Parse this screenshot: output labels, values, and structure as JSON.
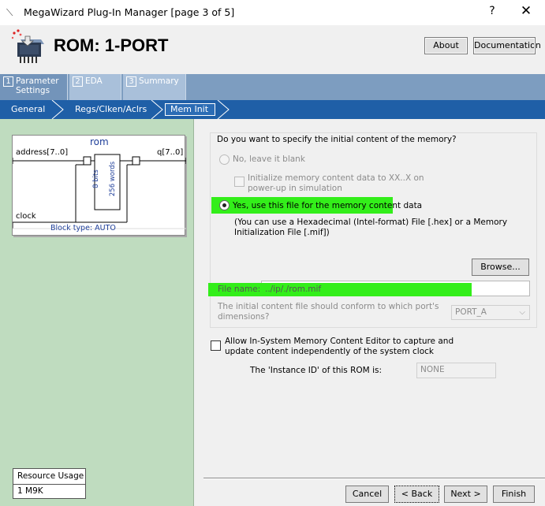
{
  "window": {
    "title": "MegaWizard Plug-In Manager [page 3 of 5]",
    "help_glyph": "?",
    "close_glyph": "✕"
  },
  "header": {
    "heading": "ROM: 1-PORT",
    "about_label": "About",
    "documentation_label": "Documentation"
  },
  "top_tabs": [
    {
      "num": "1",
      "label": "Parameter\nSettings"
    },
    {
      "num": "2",
      "label": "EDA"
    },
    {
      "num": "3",
      "label": "Summary"
    }
  ],
  "sub_tabs": [
    "General",
    "Regs/Clken/Aclrs",
    "Mem Init"
  ],
  "diagram": {
    "name": "rom",
    "address_label": "address[7..0]",
    "q_label": "q[7..0]",
    "clock_label": "clock",
    "bits": "8 bits",
    "words": "256 words",
    "block_type": "Block type: AUTO"
  },
  "resource": {
    "title": "Resource Usage",
    "value": "1 M9K"
  },
  "mem_init": {
    "question": "Do you want to specify the initial content of the memory?",
    "no_option": "No, leave it blank",
    "init_xx_line1": "Initialize memory content data to XX..X on",
    "init_xx_line2": "power-up in simulation",
    "yes_option": "Yes, use this file for the memory content data",
    "hint_line1": "(You can use a Hexadecimal (Intel-format) File [.hex] or a Memory",
    "hint_line2": "Initialization File [.mif])",
    "browse_label": "Browse...",
    "file_name_label": "File name:",
    "file_name_value": "../ip/./rom.mif",
    "port_q_line1": "The initial content file should conform to which port's",
    "port_q_line2": "dimensions?",
    "port_value": "PORT_A"
  },
  "insystem": {
    "label_line1": "Allow In-System Memory Content Editor to capture and",
    "label_line2": "update content independently of the system clock",
    "instance_label": "The 'Instance ID' of this ROM is:",
    "instance_value": "NONE"
  },
  "footer": {
    "cancel_label": "Cancel",
    "back_label": "< Back",
    "next_label": "Next >",
    "finish_label": "Finish"
  },
  "colors": {
    "highlight": "#33ee1a",
    "left_panel": "#bfdcbf",
    "tab_bar": "#7d9dc0",
    "breadcrumb_bar": "#1f5fa7"
  },
  "icons": [
    "wizard-icon",
    "rom-chip-icon",
    "chevron-down-icon"
  ]
}
